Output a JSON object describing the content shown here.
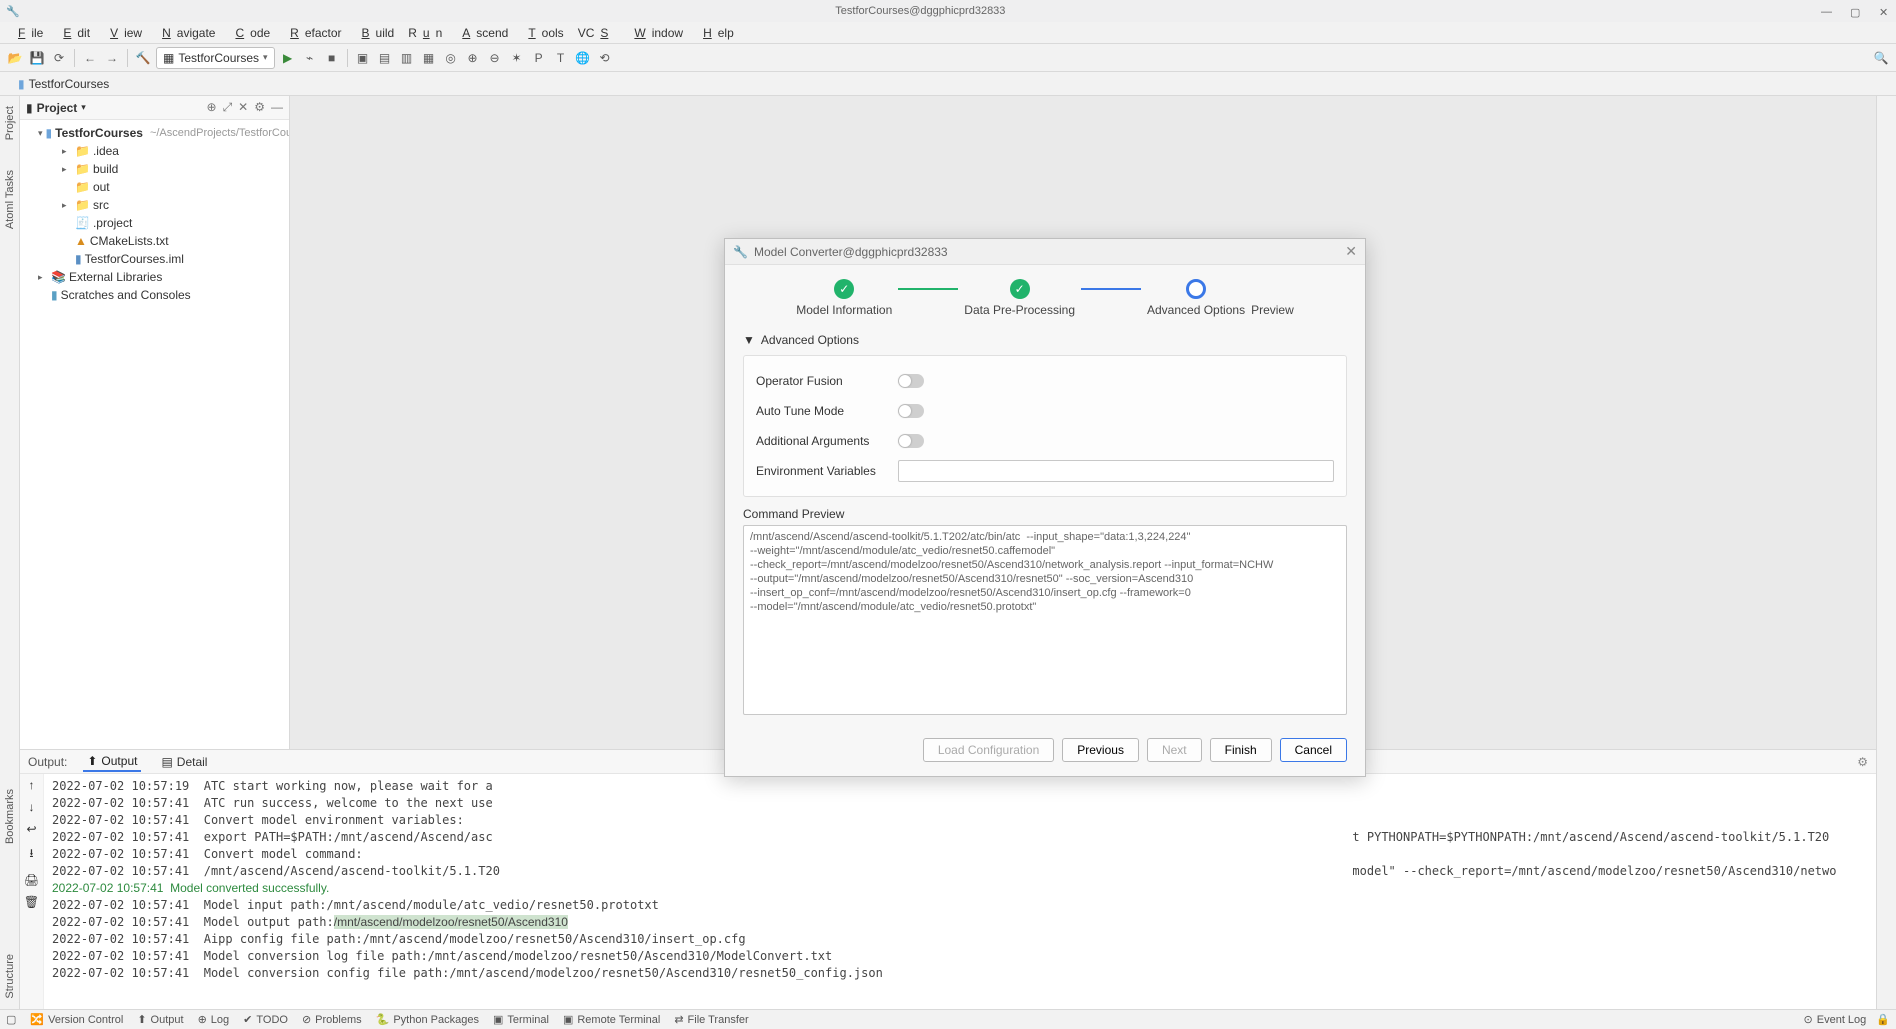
{
  "titlebar": {
    "text": "TestforCourses@dggphicprd32833"
  },
  "menu": [
    "File",
    "Edit",
    "View",
    "Navigate",
    "Code",
    "Refactor",
    "Build",
    "Run",
    "Ascend",
    "Tools",
    "VCS",
    "Window",
    "Help"
  ],
  "run_config": {
    "label": "TestforCourses"
  },
  "breadcrumb": {
    "project": "TestforCourses"
  },
  "project_panel": {
    "title": "Project",
    "root": {
      "label": "TestforCourses",
      "path": "~/AscendProjects/TestforCou"
    },
    "items": [
      {
        "label": ".idea",
        "type": "folder"
      },
      {
        "label": "build",
        "type": "folder"
      },
      {
        "label": "out",
        "type": "folder-open"
      },
      {
        "label": "src",
        "type": "folder"
      },
      {
        "label": ".project",
        "type": "file"
      },
      {
        "label": "CMakeLists.txt",
        "type": "cmake"
      },
      {
        "label": "TestforCourses.iml",
        "type": "iml"
      }
    ],
    "external": "External Libraries",
    "scratches": "Scratches and Consoles"
  },
  "output": {
    "label": "Output:",
    "tab_output": "Output",
    "tab_detail": "Detail",
    "lines": [
      {
        "ts": "2022-07-02 10:57:19",
        "msg": "ATC start working now, please wait for a"
      },
      {
        "ts": "2022-07-02 10:57:41",
        "msg": "ATC run success, welcome to the next use"
      },
      {
        "ts": "2022-07-02 10:57:41",
        "msg": "Convert model environment variables:"
      },
      {
        "ts": "2022-07-02 10:57:41",
        "msg": "export PATH=$PATH:/mnt/ascend/Ascend/asc",
        "msg_right": "t PYTHONPATH=$PYTHONPATH:/mnt/ascend/Ascend/ascend-toolkit/5.1.T20"
      },
      {
        "ts": "2022-07-02 10:57:41",
        "msg": "Convert model command:"
      },
      {
        "ts": "2022-07-02 10:57:41",
        "msg": "/mnt/ascend/Ascend/ascend-toolkit/5.1.T20",
        "msg_right": "model\" --check_report=/mnt/ascend/modelzoo/resnet50/Ascend310/netwo"
      },
      {
        "ts": "2022-07-02 10:57:41",
        "msg": "Model converted successfully.",
        "green": true
      },
      {
        "ts": "2022-07-02 10:57:41",
        "msg": "Model input path:/mnt/ascend/module/atc_vedio/resnet50.prototxt"
      },
      {
        "ts": "2022-07-02 10:57:41",
        "msg": "Model output path:",
        "hl": "/mnt/ascend/modelzoo/resnet50/Ascend310"
      },
      {
        "ts": "2022-07-02 10:57:41",
        "msg": "Aipp config file path:/mnt/ascend/modelzoo/resnet50/Ascend310/insert_op.cfg"
      },
      {
        "ts": "2022-07-02 10:57:41",
        "msg": "Model conversion log file path:/mnt/ascend/modelzoo/resnet50/Ascend310/ModelConvert.txt"
      },
      {
        "ts": "2022-07-02 10:57:41",
        "msg": "Model conversion config file path:/mnt/ascend/modelzoo/resnet50/Ascend310/resnet50_config.json"
      }
    ]
  },
  "statusbar": {
    "items": [
      "Version Control",
      "Output",
      "Log",
      "TODO",
      "Problems",
      "Python Packages",
      "Terminal",
      "Remote Terminal",
      "File Transfer"
    ],
    "event_log": "Event Log"
  },
  "dialog": {
    "title": "Model Converter@dggphicprd32833",
    "steps": [
      "Model Information",
      "Data Pre-Processing",
      "Advanced Options",
      "Preview"
    ],
    "section": "Advanced Options",
    "opts": {
      "fusion": "Operator Fusion",
      "autotune": "Auto Tune Mode",
      "addargs": "Additional Arguments",
      "env": "Environment Variables"
    },
    "cmd_label": "Command Preview",
    "cmd": "/mnt/ascend/Ascend/ascend-toolkit/5.1.T202/atc/bin/atc  --input_shape=\"data:1,3,224,224\"\n--weight=\"/mnt/ascend/module/atc_vedio/resnet50.caffemodel\"\n--check_report=/mnt/ascend/modelzoo/resnet50/Ascend310/network_analysis.report --input_format=NCHW\n--output=\"/mnt/ascend/modelzoo/resnet50/Ascend310/resnet50\" --soc_version=Ascend310\n--insert_op_conf=/mnt/ascend/modelzoo/resnet50/Ascend310/insert_op.cfg --framework=0\n--model=\"/mnt/ascend/module/atc_vedio/resnet50.prototxt\"",
    "buttons": {
      "load": "Load Configuration",
      "prev": "Previous",
      "next": "Next",
      "finish": "Finish",
      "cancel": "Cancel"
    }
  }
}
